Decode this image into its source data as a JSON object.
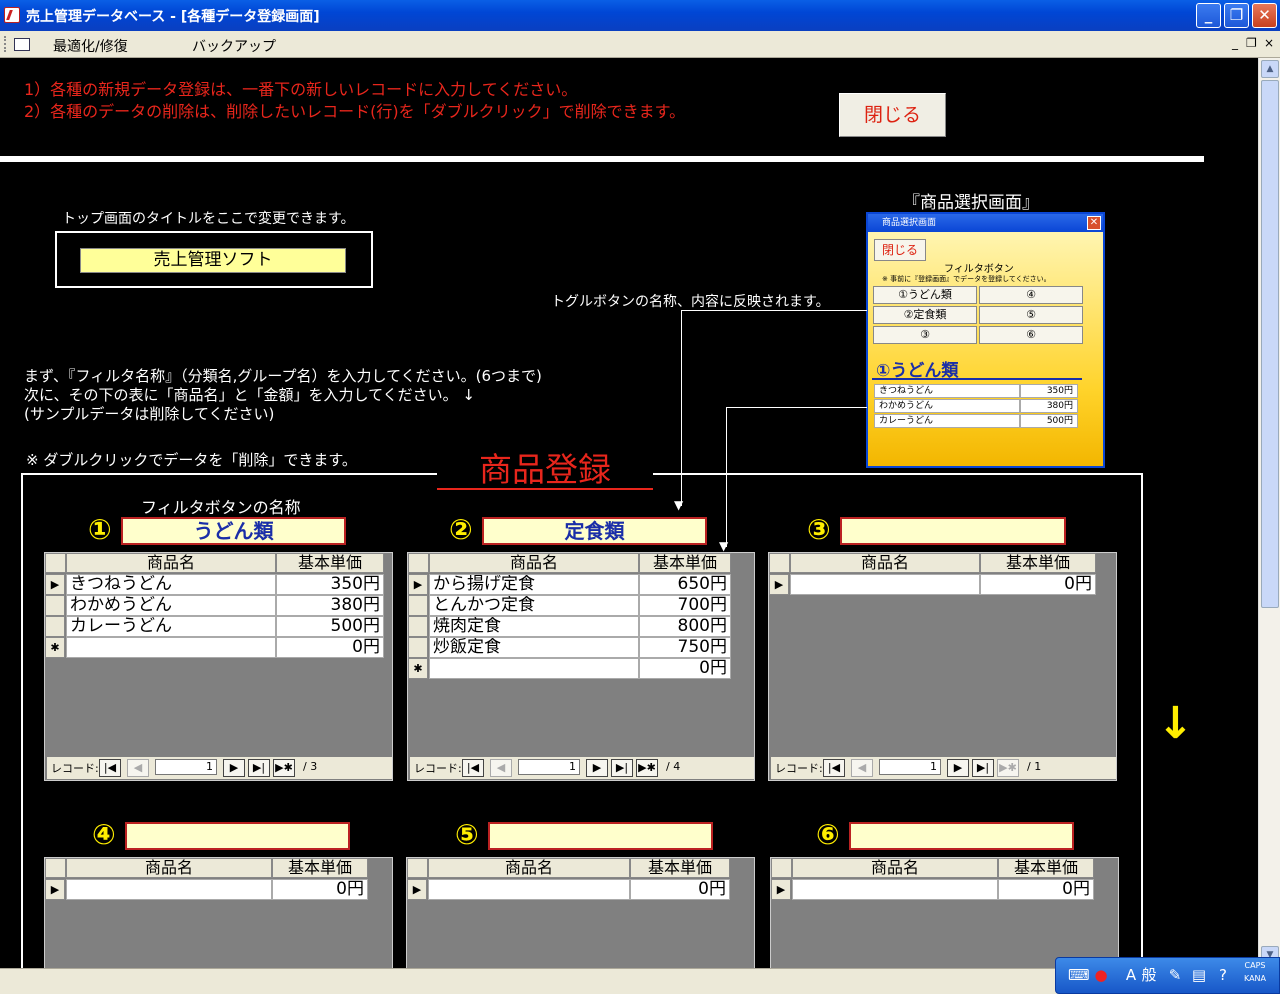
{
  "window": {
    "title": "売上管理データベース - [各種データ登録画面]"
  },
  "menu": {
    "items": [
      "最適化/修復",
      "バックアップ"
    ],
    "mdi": [
      "_",
      "❐",
      "×"
    ]
  },
  "instructions": {
    "line1": "1）各種の新規データ登録は、一番下の新しいレコードに入力してください。",
    "line2": "2）各種のデータの削除は、削除したいレコード(行)を「ダブルクリック」で削除できます。"
  },
  "close_button": "閉じる",
  "title_section": {
    "caption": "トップ画面のタイトルをここで変更できます。",
    "value": "売上管理ソフト"
  },
  "toggle_note": "トグルボタンの名称、内容に反映されます。",
  "preview": {
    "caption": "『商品選択画面』",
    "window_title": "商品選択画面",
    "close": "閉じる",
    "filter_label": "フィルタボタン",
    "note": "※ 事前に『登録画面』でデータを登録してください。",
    "toggles": [
      "①うどん類",
      "④",
      "②定食類",
      "⑤",
      "③",
      "⑥"
    ],
    "heading": "①うどん類",
    "rows": [
      {
        "name": "きつねうどん",
        "price": "350円"
      },
      {
        "name": "わかめうどん",
        "price": "380円"
      },
      {
        "name": "カレーうどん",
        "price": "500円"
      }
    ]
  },
  "guide": {
    "line1": "まず、『フィルタ名称』（分類名,グループ名）を入力してください。(6つまで)",
    "line2": "次に、その下の表に「商品名」と「金額」を入力してください。 ↓",
    "line3": "(サンプルデータは削除してください)",
    "delete_note": "※ ダブルクリックでデータを「削除」できます。"
  },
  "section_title": "商品登録",
  "filter_caption": "フィルタボタンの名称",
  "columns": {
    "name": "商品名",
    "price": "基本単価"
  },
  "nav_label": "レコード:",
  "arrow": "↓",
  "groups": [
    {
      "num": "①",
      "name": "うどん類",
      "rows": [
        {
          "name": "きつねうどん",
          "price": "350円"
        },
        {
          "name": "わかめうどん",
          "price": "380円"
        },
        {
          "name": "カレーうどん",
          "price": "500円"
        }
      ],
      "new_price": "0円",
      "record": "1",
      "total": "/ 3"
    },
    {
      "num": "②",
      "name": "定食類",
      "rows": [
        {
          "name": "から揚げ定食",
          "price": "650円"
        },
        {
          "name": "とんかつ定食",
          "price": "700円"
        },
        {
          "name": "焼肉定食",
          "price": "800円"
        },
        {
          "name": "炒飯定食",
          "price": "750円"
        }
      ],
      "new_price": "0円",
      "record": "1",
      "total": "/ 4"
    },
    {
      "num": "③",
      "name": "",
      "rows": [],
      "new_price": "0円",
      "record": "1",
      "total": "/ 1"
    },
    {
      "num": "④",
      "name": "",
      "rows": [],
      "new_price": "0円"
    },
    {
      "num": "⑤",
      "name": "",
      "rows": [],
      "new_price": "0円"
    },
    {
      "num": "⑥",
      "name": "",
      "rows": [],
      "new_price": "0円"
    }
  ],
  "tray": {
    "ime": "A",
    "mode": "般",
    "caps": "CAPS",
    "kana": "KANA"
  }
}
